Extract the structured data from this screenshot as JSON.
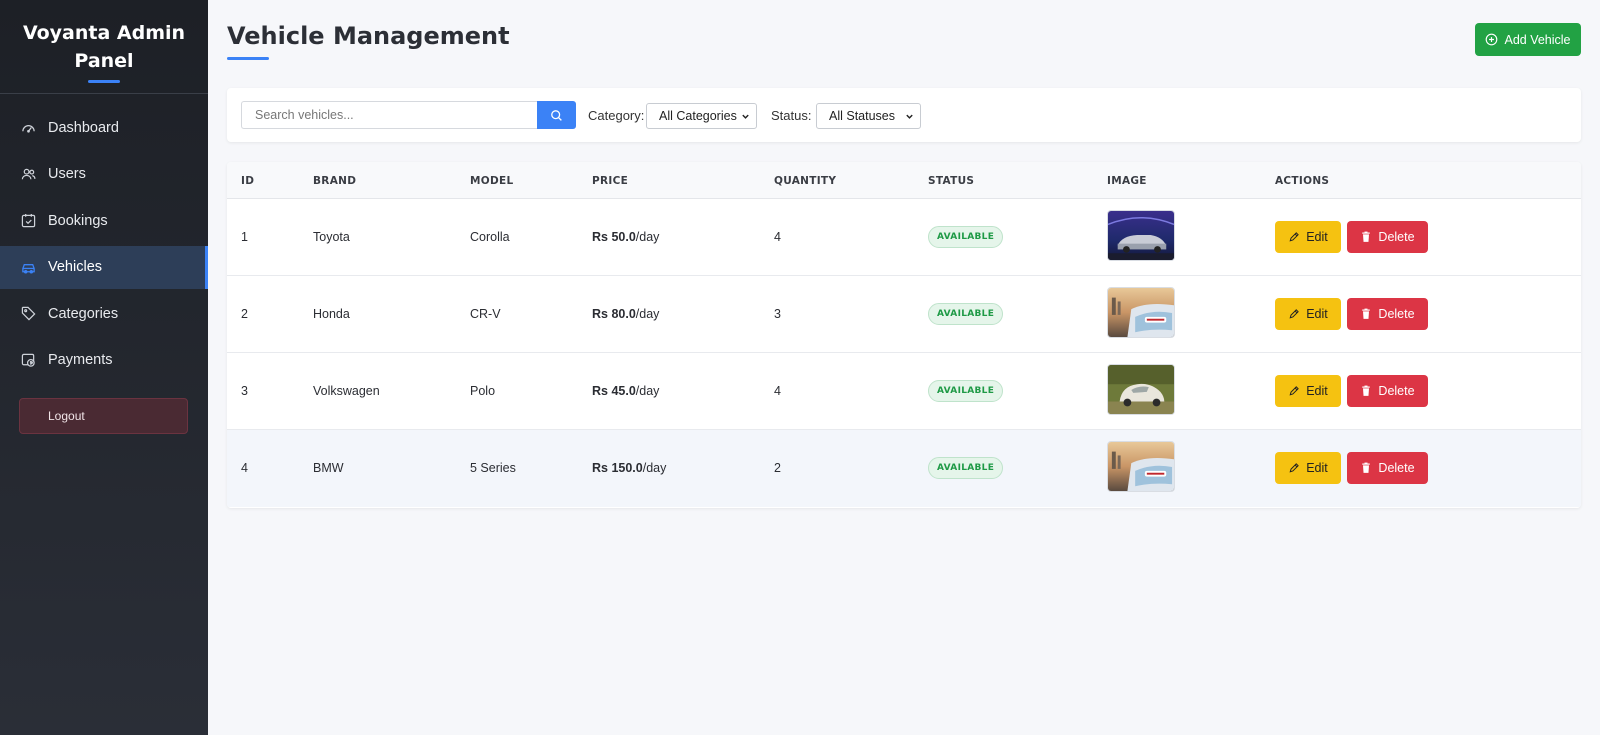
{
  "sidebar": {
    "brand_line1": "Voyanta Admin",
    "brand_line2": "Panel",
    "items": [
      {
        "label": "Dashboard",
        "icon": "gauge-icon",
        "active": false
      },
      {
        "label": "Users",
        "icon": "users-icon",
        "active": false
      },
      {
        "label": "Bookings",
        "icon": "calendar-check-icon",
        "active": false
      },
      {
        "label": "Vehicles",
        "icon": "car-icon",
        "active": true
      },
      {
        "label": "Categories",
        "icon": "tags-icon",
        "active": false
      },
      {
        "label": "Payments",
        "icon": "payment-icon",
        "active": false
      }
    ],
    "logout_label": "Logout"
  },
  "header": {
    "title": "Vehicle Management",
    "add_button_label": "Add Vehicle"
  },
  "filters": {
    "search_placeholder": "Search vehicles...",
    "search_value": "",
    "category_label": "Category:",
    "category_selected": "All Categories",
    "status_label": "Status:",
    "status_selected": "All Statuses"
  },
  "table": {
    "columns": [
      "ID",
      "BRAND",
      "MODEL",
      "PRICE",
      "QUANTITY",
      "STATUS",
      "IMAGE",
      "ACTIONS"
    ],
    "rows": [
      {
        "id": "1",
        "brand": "Toyota",
        "model": "Corolla",
        "price": "Rs 50.0",
        "price_unit": "/day",
        "quantity": "4",
        "status": "AVAILABLE",
        "image": "car-photo-dark-blue",
        "edit": "Edit",
        "delete": "Delete"
      },
      {
        "id": "2",
        "brand": "Honda",
        "model": "CR-V",
        "price": "Rs 80.0",
        "price_unit": "/day",
        "quantity": "3",
        "status": "AVAILABLE",
        "image": "car-photo-gorent-sunset",
        "edit": "Edit",
        "delete": "Delete"
      },
      {
        "id": "3",
        "brand": "Volkswagen",
        "model": "Polo",
        "price": "Rs 45.0",
        "price_unit": "/day",
        "quantity": "4",
        "status": "AVAILABLE",
        "image": "car-photo-vintage-beetle",
        "edit": "Edit",
        "delete": "Delete"
      },
      {
        "id": "4",
        "brand": "BMW",
        "model": "5 Series",
        "price": "Rs 150.0",
        "price_unit": "/day",
        "quantity": "2",
        "status": "AVAILABLE",
        "image": "car-photo-gorent-sunset",
        "edit": "Edit",
        "delete": "Delete"
      }
    ]
  },
  "colors": {
    "accent": "#3b82f6",
    "success": "#22a244",
    "warning": "#f5c211",
    "danger": "#dc3545",
    "sidebar_bg": "#1d2026"
  }
}
